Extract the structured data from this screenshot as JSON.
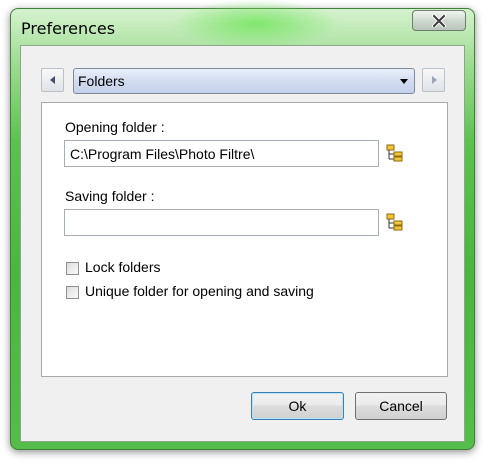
{
  "window": {
    "title": "Preferences",
    "close_icon": "close-icon"
  },
  "category_selector": {
    "selected": "Folders",
    "prev_icon": "arrow-left-icon",
    "next_icon": "arrow-right-icon",
    "dropdown_icon": "chevron-down-icon"
  },
  "folders": {
    "opening_label": "Opening folder :",
    "opening_value": "C:\\Program Files\\Photo Filtre\\",
    "saving_label": "Saving folder :",
    "saving_value": "",
    "browse_icon": "folder-tree-icon"
  },
  "options": {
    "lock_folders_label": "Lock folders",
    "lock_folders_checked": false,
    "unique_folder_label": "Unique folder for opening and saving",
    "unique_folder_checked": false
  },
  "buttons": {
    "ok_label": "Ok",
    "cancel_label": "Cancel"
  }
}
